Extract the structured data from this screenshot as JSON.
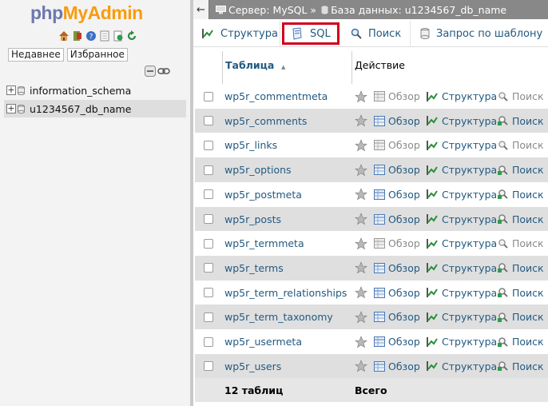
{
  "logo": {
    "part1": "php",
    "part2": "MyAdmin"
  },
  "nav": {
    "tabs": [
      "Недавнее",
      "Избранное"
    ],
    "databases": [
      "information_schema",
      "u1234567_db_name"
    ]
  },
  "breadcrumb": {
    "server": "Сервер: MySQL »",
    "database": "База данных: u1234567_db_name"
  },
  "menu": {
    "structure": "Структура",
    "sql": "SQL",
    "search": "Поиск",
    "query": "Запрос по шаблону"
  },
  "grid": {
    "col_table": "Таблица",
    "sort_glyph": "▲",
    "col_action": "Действие",
    "action_browse": "Обзор",
    "action_structure": "Структура",
    "action_search": "Поиск",
    "tables": [
      {
        "name": "wp5r_commentmeta",
        "empty": true
      },
      {
        "name": "wp5r_comments",
        "empty": false
      },
      {
        "name": "wp5r_links",
        "empty": true
      },
      {
        "name": "wp5r_options",
        "empty": false
      },
      {
        "name": "wp5r_postmeta",
        "empty": false
      },
      {
        "name": "wp5r_posts",
        "empty": false
      },
      {
        "name": "wp5r_termmeta",
        "empty": true
      },
      {
        "name": "wp5r_terms",
        "empty": false
      },
      {
        "name": "wp5r_term_relationships",
        "empty": false
      },
      {
        "name": "wp5r_term_taxonomy",
        "empty": false
      },
      {
        "name": "wp5r_usermeta",
        "empty": false
      },
      {
        "name": "wp5r_users",
        "empty": false
      }
    ],
    "footer_count": "12 таблиц",
    "footer_total": "Всего"
  },
  "colors": {
    "link": "#235a81",
    "highlight": "#d0021b",
    "alt_row": "#dfdfdf"
  }
}
